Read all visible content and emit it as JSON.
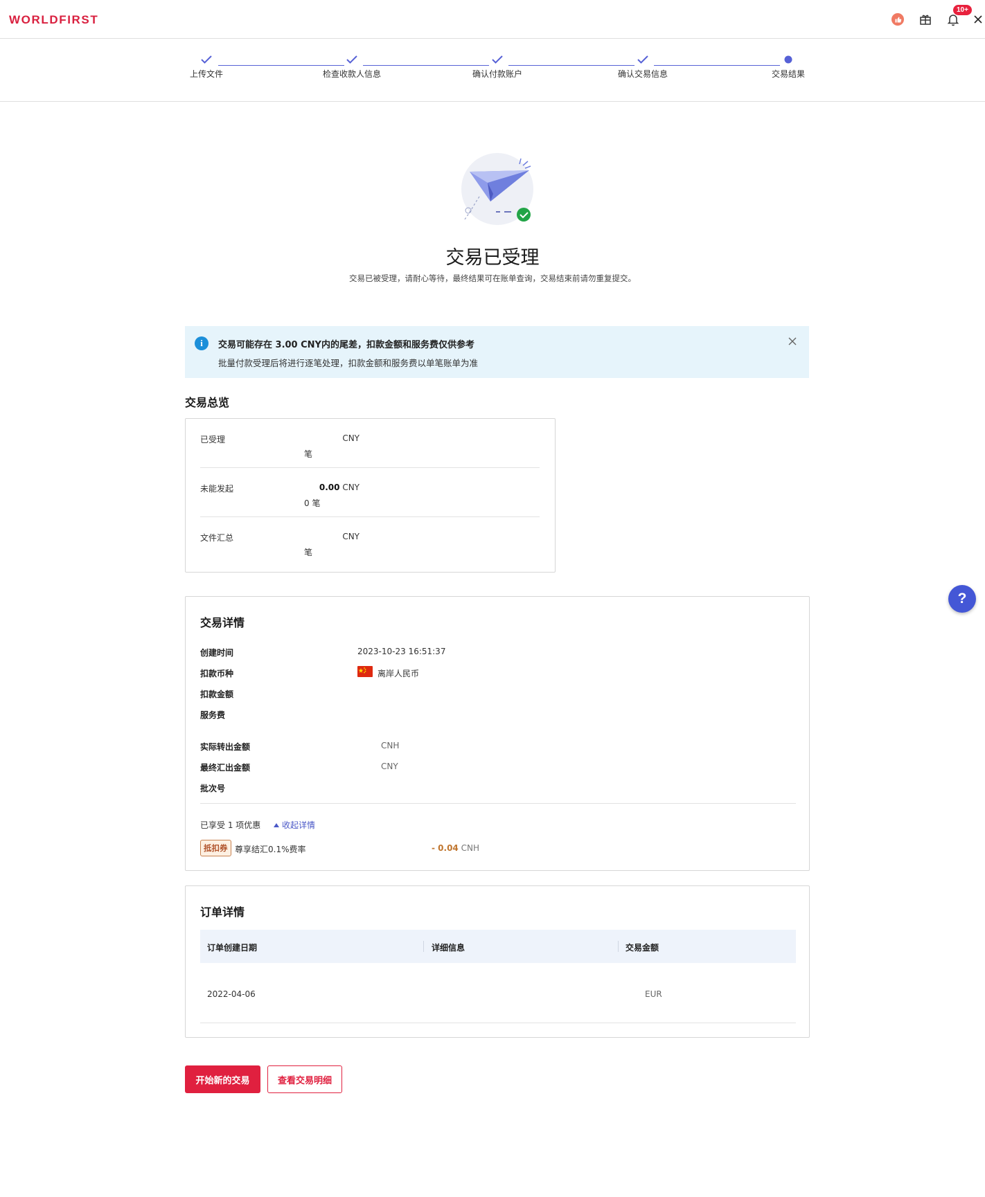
{
  "header": {
    "logo": "WORLDFIRST",
    "notification_badge": "10+"
  },
  "stepper": {
    "steps": [
      {
        "label": "上传文件",
        "state": "done"
      },
      {
        "label": "检查收款人信息",
        "state": "done"
      },
      {
        "label": "确认付款账户",
        "state": "done"
      },
      {
        "label": "确认交易信息",
        "state": "done"
      },
      {
        "label": "交易结果",
        "state": "current"
      }
    ]
  },
  "result": {
    "title": "交易已受理",
    "subtitle": "交易已被受理，请耐心等待，最终结果可在账单查询，交易结束前请勿重复提交。"
  },
  "alert": {
    "title": "交易可能存在 3.00 CNY内的尾差，扣款金额和服务费仅供参考",
    "description": "批量付款受理后将进行逐笔处理，扣款金额和服务费以单笔账单为准"
  },
  "overview": {
    "title": "交易总览",
    "rows": [
      {
        "label": "已受理",
        "amount": "",
        "currency": "CNY",
        "count": "",
        "count_unit": "笔"
      },
      {
        "label": "未能发起",
        "amount": "0.00",
        "currency": "CNY",
        "count": "0",
        "count_unit": "笔"
      },
      {
        "label": "文件汇总",
        "amount": "",
        "currency": "CNY",
        "count": "",
        "count_unit": "笔"
      }
    ]
  },
  "details": {
    "title": "交易详情",
    "created_label": "创建时间",
    "created_value": "2023-10-23 16:51:37",
    "currency_label": "扣款币种",
    "currency_value": "离岸人民币",
    "debit_amount_label": "扣款金额",
    "fee_label": "服务费",
    "actual_out_label": "实际转出金额",
    "actual_out_currency": "CNH",
    "final_out_label": "最终汇出金额",
    "final_out_currency": "CNY",
    "batch_label": "批次号",
    "promo_text": "已享受 1 项优惠",
    "collapse_link": "收起详情",
    "coupon_tag": "抵扣券",
    "coupon_name": "尊享结汇0.1%费率",
    "coupon_amount": "- 0.04",
    "coupon_currency": "CNH"
  },
  "orders": {
    "title": "订单详情",
    "columns": [
      "订单创建日期",
      "详细信息",
      "交易金额"
    ],
    "rows": [
      {
        "date": "2022-04-06",
        "info": "",
        "currency": "EUR"
      }
    ]
  },
  "actions": {
    "new_transaction": "开始新的交易",
    "view_details": "查看交易明细"
  },
  "help_label": "?",
  "colors": {
    "brand_red": "#e0203f",
    "stepper_blue": "#5661d6",
    "info_blue": "#1c8fd9",
    "success_green": "#22a447"
  }
}
